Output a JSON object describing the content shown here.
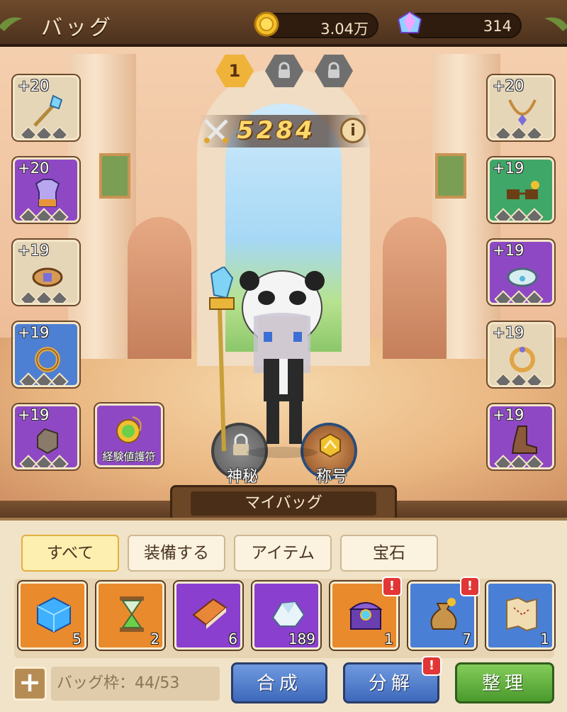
{
  "header": {
    "title": "バッグ",
    "coins": "3.04万",
    "gems": "314"
  },
  "tiers": {
    "active": "1"
  },
  "power": {
    "value": "5284",
    "info_glyph": "i"
  },
  "equipment": {
    "left": [
      {
        "level": "+20",
        "color": "tan",
        "icon": "staff-icon"
      },
      {
        "level": "+20",
        "color": "purple",
        "icon": "armor-icon"
      },
      {
        "level": "+19",
        "color": "tan",
        "icon": "belt-icon"
      },
      {
        "level": "+19",
        "color": "blue",
        "icon": "ring-icon"
      },
      {
        "level": "+19",
        "color": "purple",
        "icon": "glove-icon"
      }
    ],
    "right": [
      {
        "level": "+20",
        "color": "tan",
        "icon": "necklace-icon"
      },
      {
        "level": "+19",
        "color": "green",
        "icon": "glasses-icon"
      },
      {
        "level": "+19",
        "color": "purple",
        "icon": "bracelet-icon"
      },
      {
        "level": "+19",
        "color": "tan",
        "icon": "ring-icon"
      },
      {
        "level": "+19",
        "color": "purple",
        "icon": "boots-icon"
      }
    ],
    "amulet_label": "経験値護符",
    "mystery_label": "神秘",
    "title_label": "称号"
  },
  "bag": {
    "header": "マイバッグ",
    "tabs": [
      "すべて",
      "装備する",
      "アイテム",
      "宝石"
    ],
    "active_tab": "すべて",
    "items": [
      {
        "count": "5",
        "color": "orange",
        "icon": "cube-icon",
        "alert": false
      },
      {
        "count": "2",
        "color": "orange",
        "icon": "hourglass-icon",
        "alert": false
      },
      {
        "count": "6",
        "color": "purple",
        "icon": "book-icon",
        "alert": false
      },
      {
        "count": "189",
        "color": "purple",
        "icon": "ore-icon",
        "alert": false
      },
      {
        "count": "1",
        "color": "orange",
        "icon": "chest-icon",
        "alert": true
      },
      {
        "count": "7",
        "color": "blue",
        "icon": "coin-bag-icon",
        "alert": true
      },
      {
        "count": "1",
        "color": "blue",
        "icon": "map-icon",
        "alert": false
      }
    ],
    "alert_glyph": "!",
    "add_glyph": "+",
    "capacity": "バッグ枠：44/53",
    "buttons": {
      "synthesize": "合成",
      "decompose": "分解",
      "sort": "整理"
    }
  },
  "colors": {
    "tan": "#e6d6b8",
    "purple": "#8f48c4",
    "blue": "#4d7fd2",
    "green": "#3fa768",
    "orange": "#e98a2c"
  }
}
